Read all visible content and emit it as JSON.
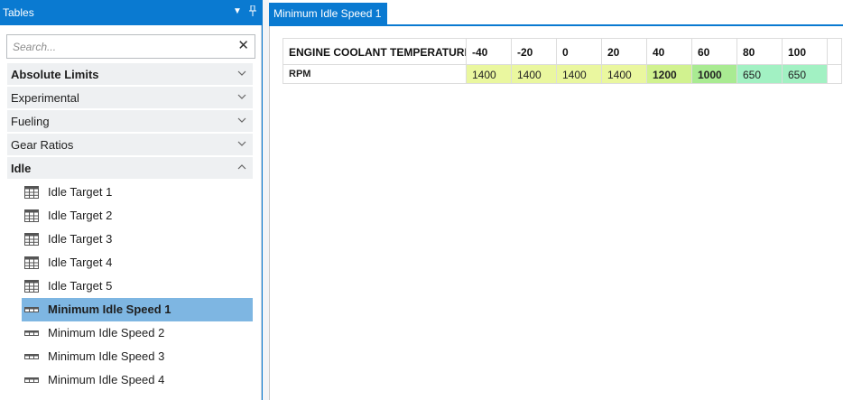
{
  "panel": {
    "title": "Tables",
    "search_placeholder": "Search...",
    "categories_top": [
      {
        "label": "Absolute Limits",
        "bold": true
      },
      {
        "label": "Experimental",
        "bold": false
      },
      {
        "label": "Fueling",
        "bold": false
      },
      {
        "label": "Gear Ratios",
        "bold": false
      }
    ],
    "idle": {
      "label": "Idle",
      "items": [
        {
          "label": "Idle Target 1",
          "icon": "table-grid-icon",
          "selected": false
        },
        {
          "label": "Idle Target 2",
          "icon": "table-grid-icon",
          "selected": false
        },
        {
          "label": "Idle Target 3",
          "icon": "table-grid-icon",
          "selected": false
        },
        {
          "label": "Idle Target 4",
          "icon": "table-grid-icon",
          "selected": false
        },
        {
          "label": "Idle Target 5",
          "icon": "table-grid-icon",
          "selected": false
        },
        {
          "label": "Minimum Idle Speed 1",
          "icon": "table-row-icon",
          "selected": true
        },
        {
          "label": "Minimum Idle Speed 2",
          "icon": "table-row-icon",
          "selected": false
        },
        {
          "label": "Minimum Idle Speed 3",
          "icon": "table-row-icon",
          "selected": false
        },
        {
          "label": "Minimum Idle Speed 4",
          "icon": "table-row-icon",
          "selected": false
        }
      ]
    }
  },
  "document": {
    "tab_label": "Minimum Idle Speed 1",
    "table": {
      "axis_label": "ENGINE COOLANT TEMPERATURE",
      "columns": [
        "-40",
        "-20",
        "0",
        "20",
        "40",
        "60",
        "80",
        "100"
      ],
      "row_label": "RPM",
      "values": [
        "1400",
        "1400",
        "1400",
        "1400",
        "1200",
        "1000",
        "650",
        "650"
      ],
      "bold": [
        false,
        false,
        false,
        false,
        true,
        true,
        false,
        false
      ],
      "colors": [
        "#eaf79f",
        "#eaf79f",
        "#eaf79f",
        "#eaf79f",
        "#d1f28f",
        "#a9eb92",
        "#a2f1c3",
        "#a2f1c3"
      ]
    }
  },
  "colors": {
    "accent": "#0a7ad1",
    "selected_row": "#7eb6e2",
    "category_bg": "#eef0f2"
  }
}
